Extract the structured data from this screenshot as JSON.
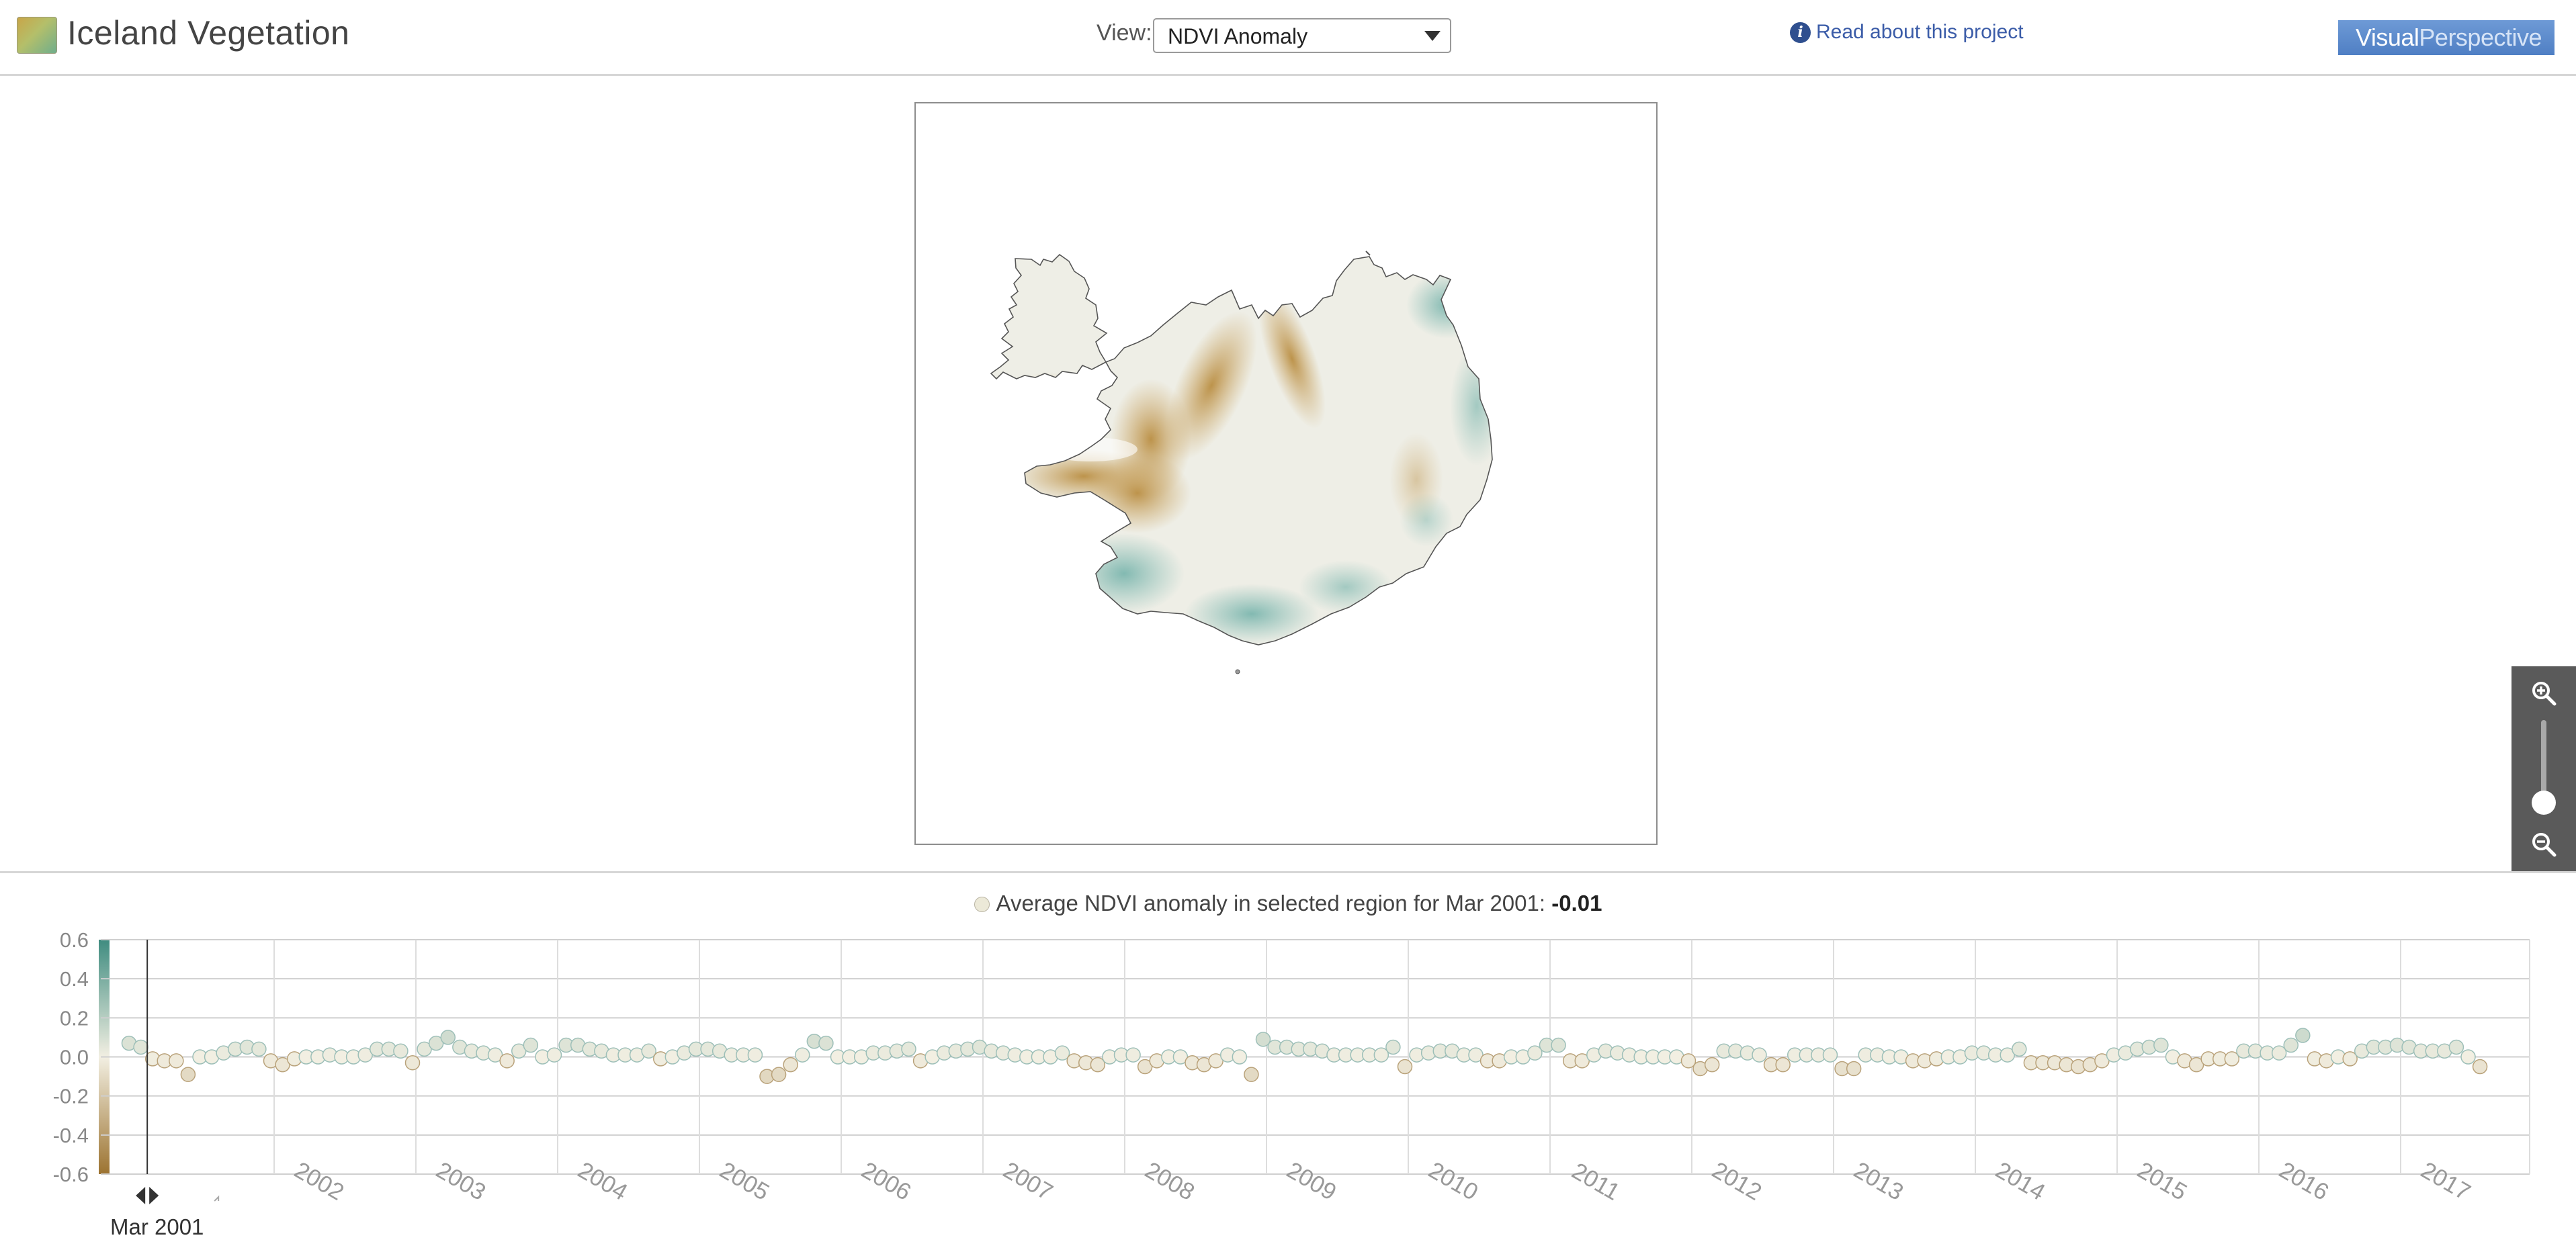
{
  "header": {
    "app_title": "Iceland Vegetation",
    "view_label": "View:",
    "view_selected": "NDVI Anomaly",
    "about_link": "Read about this project",
    "info_icon": "info-icon",
    "brand": {
      "part1": "Visual",
      "part2": "Perspective"
    }
  },
  "map": {
    "icon": "iceland-map",
    "colors": {
      "positive": "#7fb8b0",
      "negative": "#c9a15a",
      "neutral": "#eeeee6",
      "outline": "#555555"
    }
  },
  "zoom": {
    "zoom_in_icon": "zoom-in-icon",
    "zoom_out_icon": "zoom-out-icon",
    "level": 0.2
  },
  "caption": {
    "text": "Average NDVI anomaly in selected region for Mar 2001:",
    "value": "-0.01"
  },
  "selected_date": "Mar 2001",
  "chart_data": {
    "type": "scatter",
    "title": "",
    "xlabel": "",
    "ylabel": "",
    "ylim": [
      -0.6,
      0.6
    ],
    "yticks": [
      "0.6",
      "0.4",
      "0.2",
      "0.0",
      "-0.2",
      "-0.4",
      "-0.6"
    ],
    "xticks": [
      "2002",
      "2003",
      "2004",
      "2005",
      "2006",
      "2007",
      "2008",
      "2009",
      "2010",
      "2011",
      "2012",
      "2013",
      "2014",
      "2015",
      "2016",
      "2017"
    ],
    "x_start": "Jan 2001",
    "x_end": "Dec 2017",
    "grid": true,
    "colors": {
      "high": "#3f8c80",
      "zero": "#f2efe2",
      "low": "#9c7330"
    },
    "series": [
      {
        "values": [
          0.07,
          0.05,
          -0.01,
          -0.02,
          -0.02,
          -0.09,
          0.0,
          0.0,
          0.02,
          0.04,
          0.05,
          0.04,
          -0.02,
          -0.04,
          -0.01,
          0.0,
          0.0,
          0.01,
          0.0,
          0.0,
          0.01,
          0.04,
          0.04,
          0.03,
          -0.03,
          0.04,
          0.07,
          0.1,
          0.05,
          0.03,
          0.02,
          0.01,
          -0.02,
          0.03,
          0.06,
          0.0,
          0.01,
          0.06,
          0.06,
          0.04,
          0.03,
          0.01,
          0.01,
          0.01,
          0.03,
          -0.01,
          0.0,
          0.02,
          0.04,
          0.04,
          0.03,
          0.01,
          0.01,
          0.01,
          -0.1,
          -0.09,
          -0.04,
          0.01,
          0.08,
          0.07,
          0.0,
          0.0,
          0.0,
          0.02,
          0.02,
          0.03,
          0.04,
          -0.02,
          0.0,
          0.02,
          0.03,
          0.04,
          0.05,
          0.03,
          0.02,
          0.01,
          0.0,
          0.0,
          0.0,
          0.02,
          -0.02,
          -0.03,
          -0.04,
          0.0,
          0.01,
          0.01,
          -0.05,
          -0.02,
          0.0,
          0.0,
          -0.03,
          -0.04,
          -0.02,
          0.01,
          0.0,
          -0.09,
          0.09,
          0.05,
          0.05,
          0.04,
          0.04,
          0.03,
          0.01,
          0.01,
          0.01,
          0.01,
          0.01,
          0.05,
          -0.05,
          0.01,
          0.02,
          0.03,
          0.03,
          0.01,
          0.01,
          -0.02,
          -0.02,
          0.0,
          0.0,
          0.02,
          0.06,
          0.06,
          -0.02,
          -0.02,
          0.01,
          0.03,
          0.02,
          0.01,
          0.0,
          0.0,
          0.0,
          0.0,
          -0.02,
          -0.06,
          -0.04,
          0.03,
          0.03,
          0.02,
          0.01,
          -0.04,
          -0.04,
          0.01,
          0.01,
          0.01,
          0.01,
          -0.06,
          -0.06,
          0.01,
          0.01,
          0.0,
          0.0,
          -0.02,
          -0.02,
          -0.01,
          0.0,
          0.0,
          0.02,
          0.02,
          0.01,
          0.01,
          0.04,
          -0.03,
          -0.03,
          -0.03,
          -0.04,
          -0.05,
          -0.04,
          -0.02,
          0.01,
          0.02,
          0.04,
          0.05,
          0.06,
          0.0,
          -0.02,
          -0.04,
          -0.01,
          -0.01,
          -0.01,
          0.03,
          0.03,
          0.02,
          0.02,
          0.06,
          0.11,
          -0.01,
          -0.02,
          0.0,
          -0.01,
          0.03,
          0.05,
          0.05,
          0.06,
          0.05,
          0.03,
          0.03,
          0.03,
          0.05,
          0.0,
          -0.05
        ]
      }
    ]
  }
}
